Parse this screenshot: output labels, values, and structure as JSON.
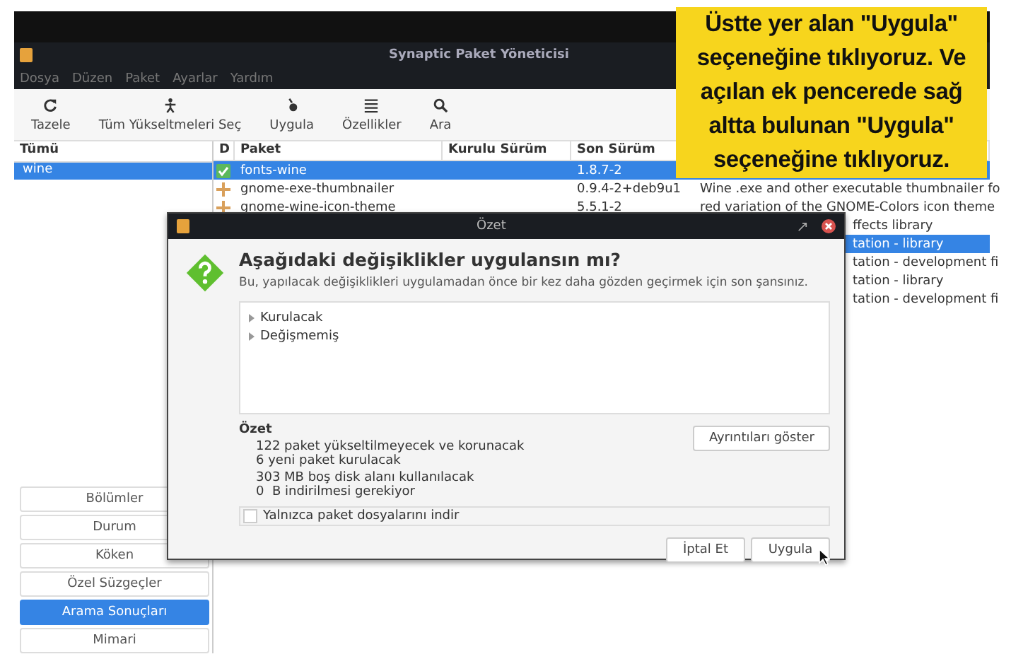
{
  "window": {
    "title": "Synaptic Paket Yöneticisi"
  },
  "menu": [
    "Dosya",
    "Düzen",
    "Paket",
    "Ayarlar",
    "Yardım"
  ],
  "toolbar": [
    {
      "kind": "refresh",
      "label": "Tazele"
    },
    {
      "kind": "upgrade",
      "label": "Tüm Yükseltmeleri Seç"
    },
    {
      "kind": "apply",
      "label": "Uygula"
    },
    {
      "kind": "properties",
      "label": "Özellikler"
    },
    {
      "kind": "search",
      "label": "Ara"
    }
  ],
  "filter_list": {
    "header": "Tümü",
    "items": [
      {
        "label": "wine",
        "selected": true
      }
    ]
  },
  "filter_buttons": [
    {
      "label": "Bölümler",
      "selected": false
    },
    {
      "label": "Durum",
      "selected": false
    },
    {
      "label": "Köken",
      "selected": false
    },
    {
      "label": "Özel Süzgeçler",
      "selected": false
    },
    {
      "label": "Arama Sonuçları",
      "selected": true
    },
    {
      "label": "Mimari",
      "selected": false
    }
  ],
  "table": {
    "columns": [
      "D",
      "Paket",
      "Kurulu Sürüm",
      "Son Sürüm"
    ],
    "rows": [
      {
        "kind": "full",
        "marked": true,
        "package": "fonts-wine",
        "latest": "1.8.7-2",
        "selected": true
      },
      {
        "kind": "full",
        "marked": false,
        "package": "gnome-exe-thumbnailer",
        "latest": "0.9.4-2+deb9u1",
        "description": "Wine .exe and other executable thumbnailer fo",
        "selected": false
      },
      {
        "kind": "full",
        "marked": false,
        "package": "gnome-wine-icon-theme",
        "latest": "5.5.1-2",
        "description": "red variation of the GNOME-Colors icon theme",
        "selected": false
      },
      {
        "kind": "tail",
        "description": "ffects library",
        "selected": false
      },
      {
        "kind": "tail",
        "description": "tation - library",
        "selected": true
      },
      {
        "kind": "tail",
        "description": "tation - development fi",
        "selected": false
      },
      {
        "kind": "tail",
        "description": "tation - library",
        "selected": false
      },
      {
        "kind": "tail",
        "description": "tation - development fi",
        "selected": false
      }
    ]
  },
  "dialog": {
    "title": "Özet",
    "heading": "Aşağıdaki değişiklikler uygulansın mı?",
    "text": "Bu, yapılacak değişiklikleri uygulamadan önce bir kez daha gözden geçirmek için son şansınız.",
    "changes": [
      {
        "label": "Kurulacak",
        "expanded": false
      },
      {
        "label": "Değişmemiş",
        "expanded": false
      }
    ],
    "summary_title": "Özet",
    "summary_groups": [
      [
        "122 paket yükseltilmeyecek ve korunacak",
        "6 yeni paket kurulacak"
      ],
      [
        "303 MB boş disk alanı kullanılacak",
        "0  B indirilmesi gerekiyor"
      ]
    ],
    "details_button": "Ayrıntıları göster",
    "download_only": {
      "label": "Yalnızca paket dosyalarını indir",
      "checked": false
    },
    "buttons": [
      "İptal Et",
      "Uygula"
    ]
  },
  "callout": {
    "text": "Üstte yer alan \"Uygula\" seçeneğine tıklıyoruz. Ve açılan ek pencerede sağ altta bulunan \"Uygula\" seçeneğine tıklıyoruz."
  }
}
